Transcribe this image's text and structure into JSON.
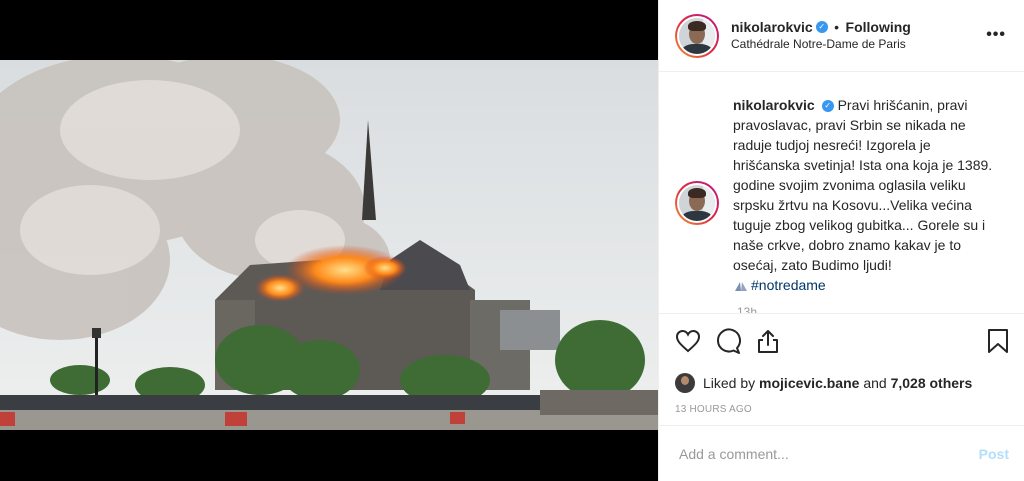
{
  "post": {
    "username": "nikolarokvic",
    "follow_label": "Following",
    "location": "Cathédrale Notre-Dame de Paris",
    "more_label": "•••"
  },
  "caption": {
    "username": "nikolarokvic",
    "text": "Pravi hrišćanin, pravi pravoslavac, pravi Srbin se nikada ne raduje tudjoj nesreći! Izgorela je hrišćanska svetinja! Ista ona koja je 1389. godine svojim zvonima oglasila veliku srpsku žrtvu na Kosovu...Velika većina tuguje zbog velikog gubitka... Gorele su i naše crkve, dobro znamo kakav je to osećaj, zato Budimo ljudi!",
    "hashtag": "#notredame",
    "timestamp_peek": "13h"
  },
  "likes": {
    "prefix": "Liked by",
    "user": "mojicevic.bane",
    "and": "and",
    "count": "7,028 others"
  },
  "time_ago": "13 HOURS AGO",
  "comment_box": {
    "placeholder": "Add a comment...",
    "post_label": "Post"
  },
  "icons": [
    "heart-icon",
    "comment-icon",
    "share-icon",
    "bookmark-icon",
    "verified-badge-icon",
    "praying-hands-icon"
  ],
  "colors": {
    "verified": "#3897f0",
    "hashtag": "#003569",
    "post_disabled": "#b2dffc"
  }
}
